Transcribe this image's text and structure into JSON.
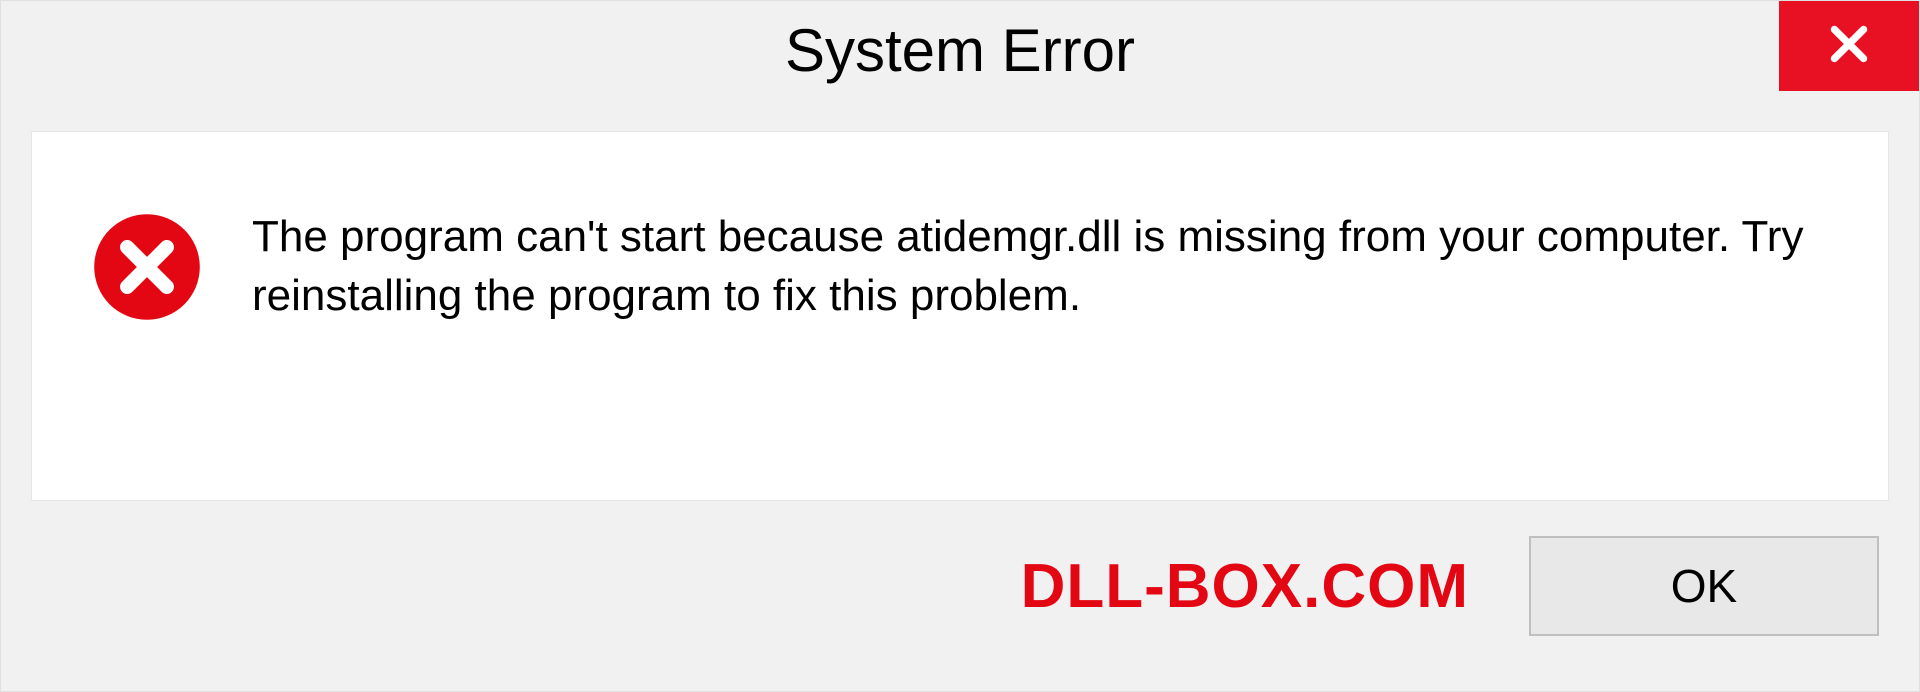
{
  "titlebar": {
    "title": "System Error"
  },
  "message": {
    "text": "The program can't start because atidemgr.dll is missing from your computer. Try reinstalling the program to fix this problem."
  },
  "footer": {
    "watermark": "DLL-BOX.COM",
    "ok_label": "OK"
  }
}
